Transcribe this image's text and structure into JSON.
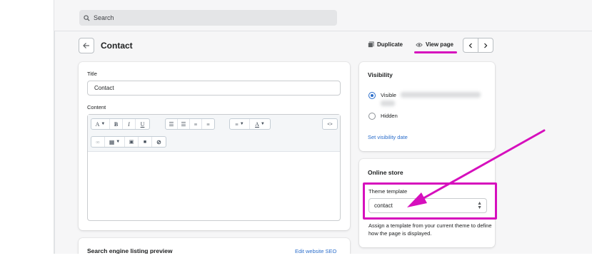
{
  "search": {
    "placeholder": "Search"
  },
  "header": {
    "title": "Contact",
    "duplicate_label": "Duplicate",
    "view_page_label": "View page"
  },
  "editor": {
    "title_label": "Title",
    "title_value": "Contact",
    "content_label": "Content",
    "toolbar": {
      "para_letter": "A",
      "bold": "B",
      "italic": "I",
      "underline": "U",
      "color_letter": "A",
      "code": "<>"
    }
  },
  "seo": {
    "heading": "Search engine listing preview",
    "edit_link": "Edit website SEO"
  },
  "visibility": {
    "heading": "Visibility",
    "visible_label": "Visible",
    "hidden_label": "Hidden",
    "set_date_link": "Set visibility date"
  },
  "online_store": {
    "heading": "Online store",
    "theme_label": "Theme template",
    "template_value": "contact",
    "description": "Assign a template from your current theme to define how the page is displayed."
  },
  "colors": {
    "annotation": "#d60fbd",
    "link": "#2c6ecb"
  }
}
